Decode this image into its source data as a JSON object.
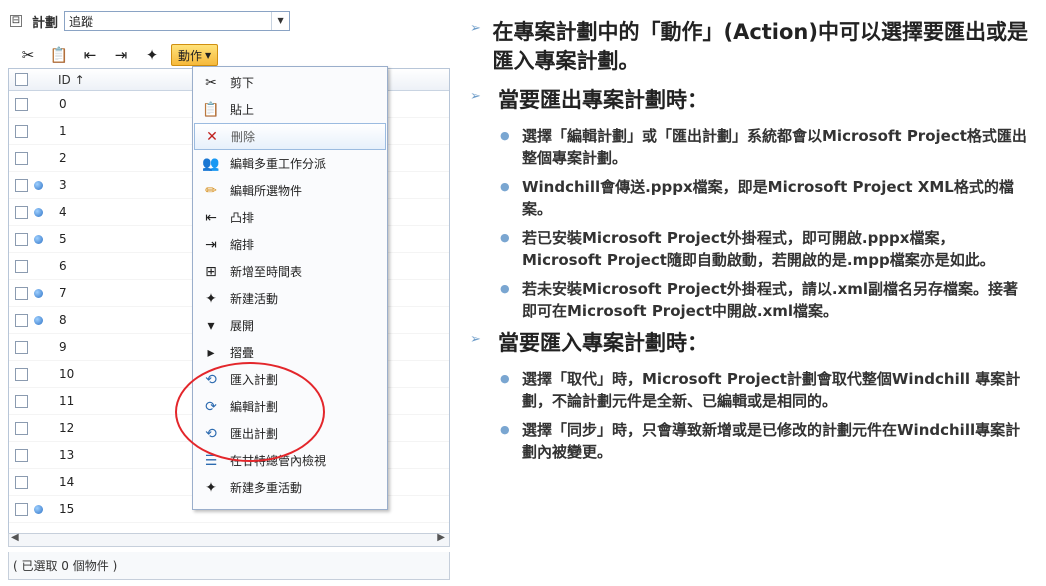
{
  "header": {
    "collapse_symbol": "⊟",
    "title": "計劃",
    "view_value": "追蹤"
  },
  "toolbar": {
    "icons": [
      "cut-icon",
      "paste-icon",
      "outdent-icon",
      "indent-icon",
      "new-activity-icon"
    ],
    "action_label": "動作"
  },
  "grid": {
    "id_header": "ID ↑",
    "rows": [
      {
        "id": "0",
        "marker": false
      },
      {
        "id": "1",
        "marker": false
      },
      {
        "id": "2",
        "marker": false
      },
      {
        "id": "3",
        "marker": true
      },
      {
        "id": "4",
        "marker": true
      },
      {
        "id": "5",
        "marker": true
      },
      {
        "id": "6",
        "marker": false
      },
      {
        "id": "7",
        "marker": true
      },
      {
        "id": "8",
        "marker": true
      },
      {
        "id": "9",
        "marker": false
      },
      {
        "id": "10",
        "marker": false
      },
      {
        "id": "11",
        "marker": false
      },
      {
        "id": "12",
        "marker": false
      },
      {
        "id": "13",
        "marker": false
      },
      {
        "id": "14",
        "marker": false
      },
      {
        "id": "15",
        "marker": true
      }
    ],
    "status": "( 已選取 0 個物件 )"
  },
  "action_menu": {
    "items": [
      {
        "label": "剪下",
        "icon": "cut-icon",
        "glyph": "✂"
      },
      {
        "label": "貼上",
        "icon": "paste-icon",
        "glyph": "📋"
      },
      {
        "label": "刪除",
        "icon": "delete-icon",
        "glyph": "✕"
      },
      {
        "label": "編輯多重工作分派",
        "icon": "multi-assign-icon",
        "glyph": "👥"
      },
      {
        "label": "編輯所選物件",
        "icon": "pencil-icon",
        "glyph": "✏"
      },
      {
        "label": "凸排",
        "icon": "outdent-icon",
        "glyph": "⇤"
      },
      {
        "label": "縮排",
        "icon": "indent-icon",
        "glyph": "⇥"
      },
      {
        "label": "新增至時間表",
        "icon": "add-timesheet-icon",
        "glyph": "⊞"
      },
      {
        "label": "新建活動",
        "icon": "new-activity-icon",
        "glyph": "✦"
      },
      {
        "label": "展開",
        "icon": "expand-icon",
        "glyph": "▾"
      },
      {
        "label": "摺疊",
        "icon": "collapse-icon",
        "glyph": "▸"
      },
      {
        "label": "匯入計劃",
        "icon": "import-plan-icon",
        "glyph": "⟲"
      },
      {
        "label": "編輯計劃",
        "icon": "edit-plan-icon",
        "glyph": "⟳"
      },
      {
        "label": "匯出計劃",
        "icon": "export-plan-icon",
        "glyph": "⟲"
      },
      {
        "label": "在甘特總管內檢視",
        "icon": "gantt-icon",
        "glyph": "☰"
      },
      {
        "label": "新建多重活動",
        "icon": "multi-activity-icon",
        "glyph": "✦"
      }
    ]
  },
  "notes": {
    "b1": "在專案計劃中的「動作」(Action)中可以選擇要匯出或是匯入專案計劃。",
    "b2": "當要匯出專案計劃時：",
    "b2_items": [
      "選擇「編輯計劃」或「匯出計劃」系統都會以Microsoft Project格式匯出整個專案計劃。",
      "Windchill會傳送.pppx檔案，即是Microsoft Project XML格式的檔案。",
      "若已安裝Microsoft Project外掛程式，即可開啟.pppx檔案，Microsoft Project隨即自動啟動，若開啟的是.mpp檔案亦是如此。",
      "若未安裝Microsoft Project外掛程式，請以.xml副檔名另存檔案。接著即可在Microsoft Project中開啟.xml檔案。"
    ],
    "b3": "當要匯入專案計劃時：",
    "b3_items": [
      "選擇「取代」時，Microsoft Project計劃會取代整個Windchill 專案計劃，不論計劃元件是全新、已編輯或是相同的。",
      "選擇「同步」時，只會導致新增或是已修改的計劃元件在Windchill專案計劃內被變更。"
    ]
  }
}
